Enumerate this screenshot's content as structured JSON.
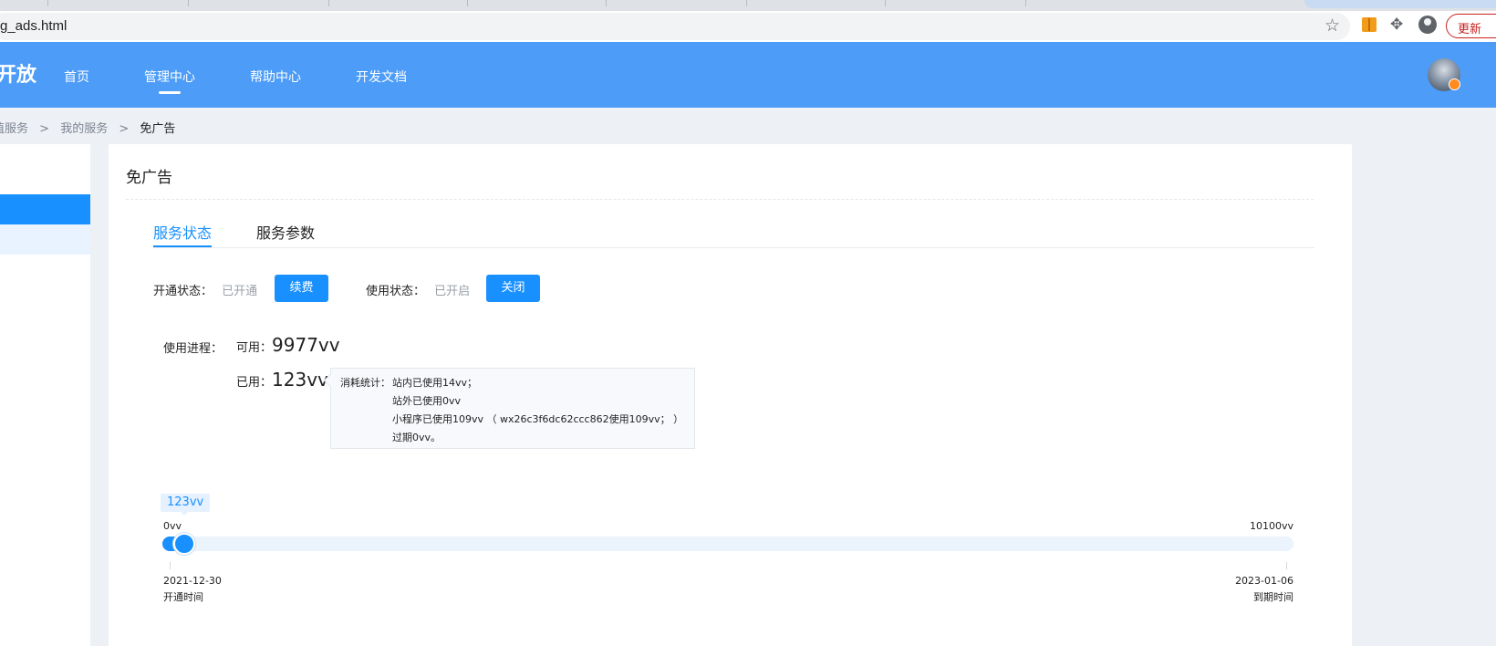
{
  "browser": {
    "url": "g_ads.html",
    "update_button": "更新"
  },
  "header": {
    "brand": "开放",
    "nav": [
      "首页",
      "管理中心",
      "帮助中心",
      "开发文档"
    ],
    "active_nav": "管理中心"
  },
  "breadcrumb": {
    "items": [
      "值服务",
      "我的服务"
    ],
    "separator": ">",
    "current": "免广告"
  },
  "card": {
    "title": "免广告",
    "tabs": [
      "服务状态",
      "服务参数"
    ],
    "active_tab": "服务状态"
  },
  "status": {
    "open_label": "开通状态：",
    "open_value": "已开通",
    "renew_button": "续费",
    "use_label": "使用状态：",
    "use_value": "已开启",
    "close_button": "关闭"
  },
  "usage": {
    "progress_label": "使用进程：",
    "available_label": "可用：",
    "available_value": "9977vv",
    "used_label": "已用：",
    "used_value": "123vv"
  },
  "tooltip": {
    "prefix": "消耗统计：",
    "lines": [
      "站内已使用14vv；",
      "站外已使用0vv",
      "小程序已使用109vv （ wx26c3f6dc62ccc862使用109vv； ）",
      "过期0vv。"
    ]
  },
  "slider": {
    "current_label": "123vv",
    "min_label": "0vv",
    "max_label": "10100vv",
    "value": 123,
    "min": 0,
    "max": 10100,
    "start_date": "2021-12-30",
    "start_label": "开通时间",
    "end_date": "2023-01-06",
    "end_label": "到期时间"
  },
  "colors": {
    "header": "#4c9cf8",
    "accent": "#1890ff",
    "page_bg": "#edf0f5"
  }
}
